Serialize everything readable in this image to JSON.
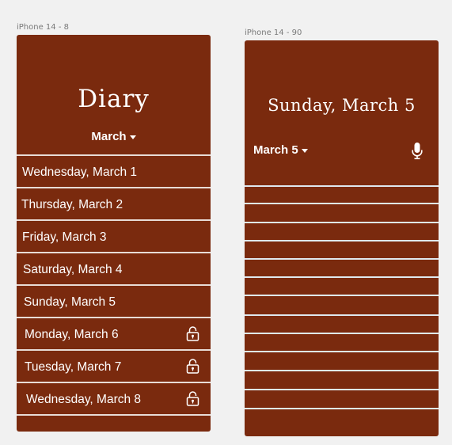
{
  "frames": {
    "left_label": "iPhone 14 - 8",
    "right_label": "iPhone 14 - 90"
  },
  "diary": {
    "title": "Diary",
    "month": "March",
    "days": [
      {
        "label": "Wednesday, March 1",
        "locked": false
      },
      {
        "label": "Thursday, March 2",
        "locked": false
      },
      {
        "label": "Friday, March 3",
        "locked": false
      },
      {
        "label": "Saturday, March 4",
        "locked": false
      },
      {
        "label": "Sunday, March 5",
        "locked": false
      },
      {
        "label": "Monday, March 6",
        "locked": true
      },
      {
        "label": "Tuesday, March 7",
        "locked": true
      },
      {
        "label": "Wednesday, March 8",
        "locked": true
      }
    ]
  },
  "entry": {
    "title": "Sunday, March 5",
    "date_select": "March 5",
    "mic_icon": "microphone-icon",
    "line_count": 13
  },
  "colors": {
    "background": "#f1f1f1",
    "brand": "#7a2a0e",
    "divider": "#e8dcd6",
    "text": "#ffffff"
  }
}
